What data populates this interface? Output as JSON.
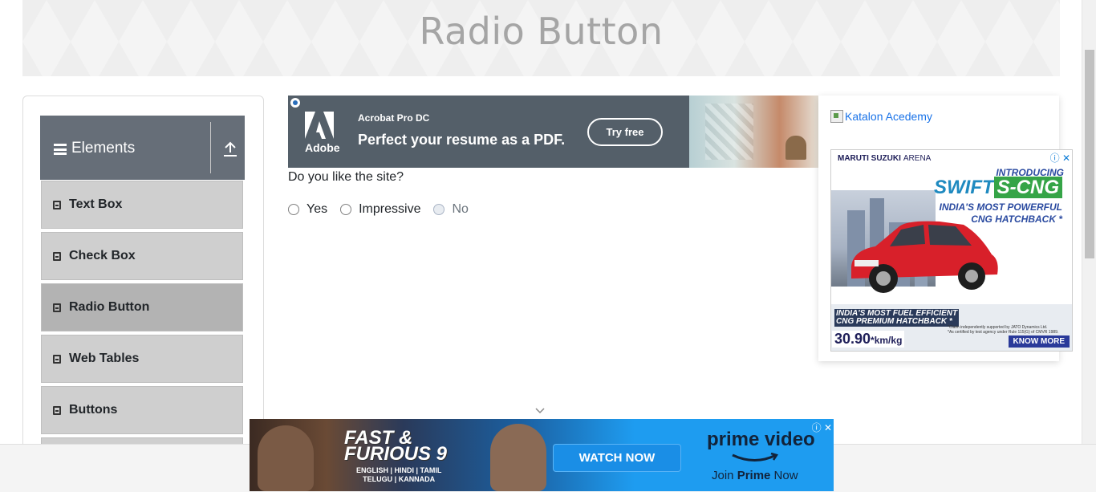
{
  "header": {
    "title": "Radio Button"
  },
  "sidebar": {
    "group_title": "Elements",
    "items": [
      {
        "label": "Text Box"
      },
      {
        "label": "Check Box"
      },
      {
        "label": "Radio Button"
      },
      {
        "label": "Web Tables"
      },
      {
        "label": "Buttons"
      }
    ],
    "active_item": "Radio Button"
  },
  "ad_adobe": {
    "logo_text": "Adobe",
    "product": "Acrobat Pro DC",
    "tagline": "Perfect your resume as a PDF.",
    "cta": "Try free"
  },
  "form": {
    "question": "Do you like the site?",
    "options": [
      {
        "label": "Yes",
        "disabled": false
      },
      {
        "label": "Impressive",
        "disabled": false
      },
      {
        "label": "No",
        "disabled": true
      }
    ]
  },
  "right_panel": {
    "broken_image_alt": "Katalon Acedemy"
  },
  "ad_maruti": {
    "brand": "MARUTI SUZUKI",
    "brand_sub": "ARENA",
    "introducing": "INTRODUCING",
    "model": "SWIFT",
    "model_variant": "S-CNG",
    "headline_1": "INDIA'S MOST POWERFUL",
    "headline_2": "CNG HATCHBACK *",
    "efficient_1": "INDIA'S MOST FUEL EFFICIENT",
    "efficient_2": "CNG PREMIUM HATCHBACK *",
    "claim_1": "*Claim independently supported by JATO Dynamics Ltd.",
    "claim_2": "*As certified by test agency under Rule 115(G) of CMVR 1989.",
    "mileage": "30.90",
    "mileage_unit": "*km/kg",
    "cta": "KNOW MORE"
  },
  "ad_prime": {
    "title_1": "FAST &",
    "title_2": "FURIOUS 9",
    "languages_1": "ENGLISH | HINDI | TAMIL",
    "languages_2": "TELUGU | KANNADA",
    "cta": "WATCH NOW",
    "brand": "prime video",
    "join_prefix": "Join ",
    "join_bold": "Prime",
    "join_suffix": " Now"
  },
  "colors": {
    "group_header_bg": "#666e78",
    "menu_item_bg": "#cfcfcf",
    "menu_item_active_bg": "#b3b3b3",
    "header_title": "#a5a5a5",
    "link": "#1a73e8"
  }
}
